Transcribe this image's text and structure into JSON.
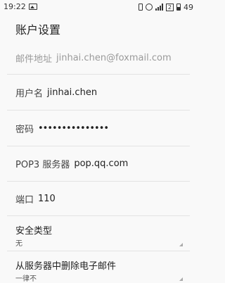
{
  "status_bar": {
    "time": "19:22",
    "sim_badge": "2",
    "battery": "49"
  },
  "header": {
    "title": "账户设置"
  },
  "fields": {
    "email": {
      "label": "邮件地址",
      "value": "jinhai.chen@foxmail.com"
    },
    "username": {
      "label": "用户名",
      "value": "jinhai.chen"
    },
    "password": {
      "label": "密码",
      "value": "•••••••••••••••"
    },
    "server": {
      "label": "POP3 服务器",
      "value": "pop.qq.com"
    },
    "port": {
      "label": "端口",
      "value": "110"
    },
    "security": {
      "label": "安全类型",
      "value": "无"
    },
    "delete": {
      "label": "从服务器中删除电子邮件",
      "value": "一律不"
    }
  }
}
